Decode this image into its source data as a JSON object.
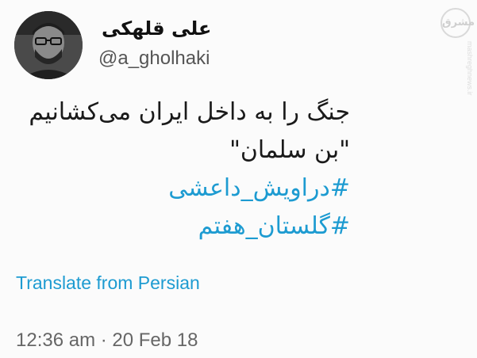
{
  "author": {
    "display_name": "علی قلهکی",
    "handle": "@a_gholhaki"
  },
  "tweet": {
    "lines": [
      "جنگ را به داخل ایران می‌کشانیم",
      "\"بن سلمان\""
    ],
    "hashtags": [
      "#دراویش_داعشی",
      "#گلستان_هفتم"
    ],
    "translate_label": "Translate from Persian",
    "timestamp": "12:36 am · 20 Feb 18"
  },
  "watermark": {
    "logo_text": "مشرق",
    "side_text": "mashreghnews.ir"
  },
  "colors": {
    "accent": "#1d9bd1",
    "text": "#1a1a1a",
    "muted": "#666666"
  }
}
